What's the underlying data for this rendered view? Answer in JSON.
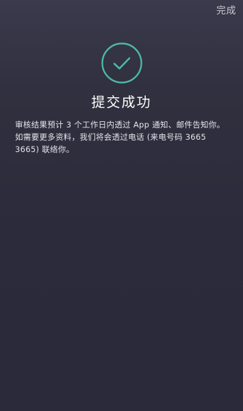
{
  "topbar": {
    "done_label": "完成"
  },
  "icons": {
    "success": "check-circle-icon"
  },
  "colors": {
    "accent": "#4fb8a6",
    "background_top": "#3a3a4d",
    "background_bottom": "#2a2a3a"
  },
  "main": {
    "title": "提交成功",
    "message": "审核结果预计 3 个工作日内透过 App 通知、邮件告知你。如需要更多资料，我们将会透过电话 (来电号码 3665 3665) 联络你。"
  }
}
